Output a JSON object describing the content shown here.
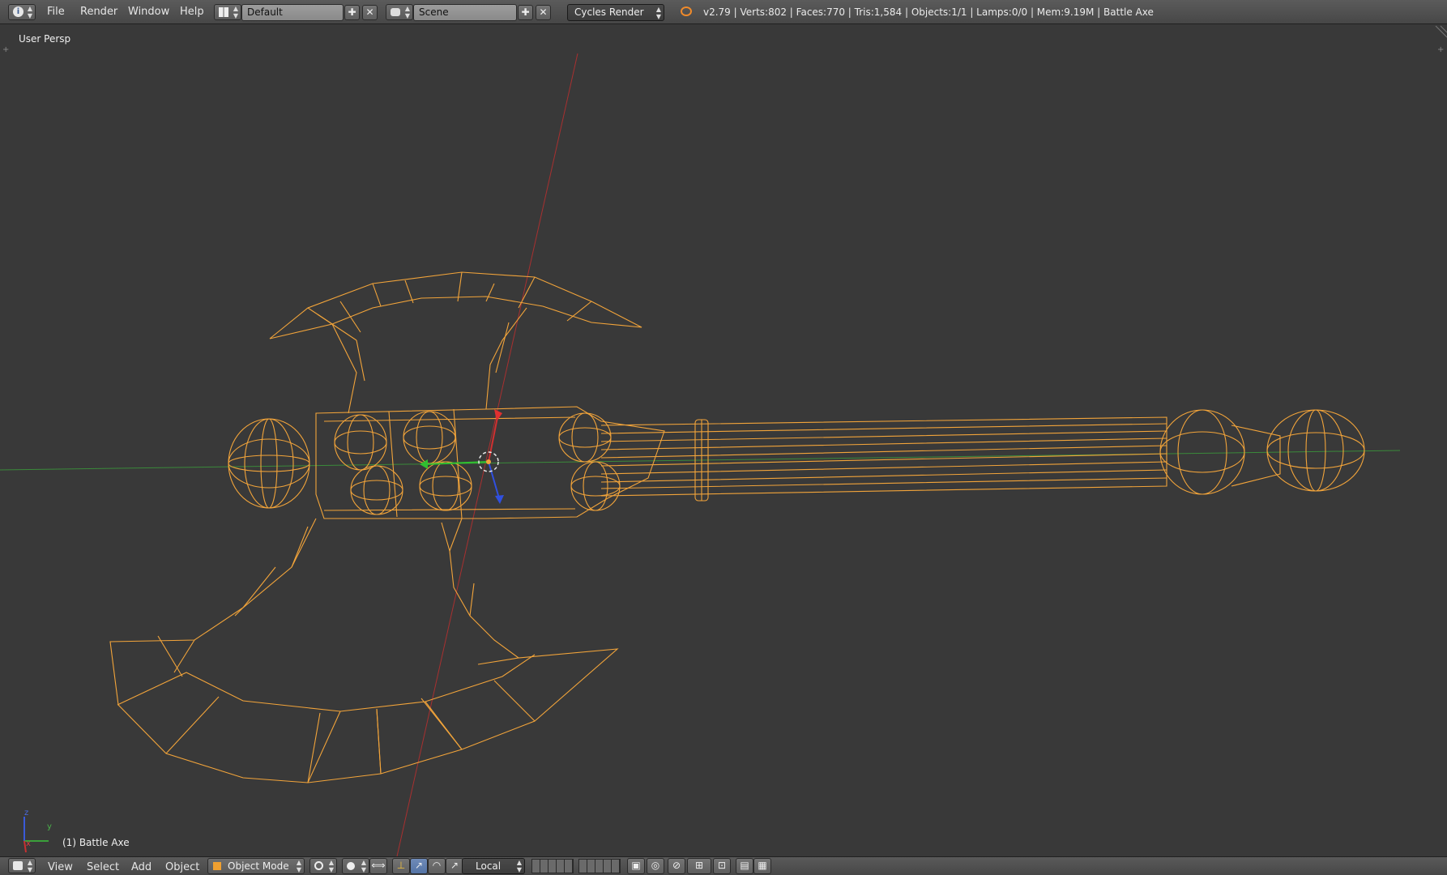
{
  "top_header": {
    "info_editor_icon": "info-icon",
    "menus": [
      "File",
      "Render",
      "Window",
      "Help"
    ],
    "screen_layout": "Default",
    "scene": "Scene",
    "render_engine": "Cycles Render",
    "stats": "v2.79 | Verts:802 | Faces:770 | Tris:1,584 | Objects:1/1 | Lamps:0/0 | Mem:9.19M | Battle Axe"
  },
  "viewport": {
    "view_name": "User Persp",
    "active_object": "(1) Battle Axe",
    "axis_labels": {
      "z": "z",
      "y": "y",
      "x": "x"
    },
    "wire_color": "#f2a43a",
    "x_axis_color": "#b03030",
    "y_axis_color": "#3a9a3a"
  },
  "bottom_header": {
    "menus": [
      "View",
      "Select",
      "Add",
      "Object"
    ],
    "mode": "Object Mode",
    "pivot": "Local"
  }
}
